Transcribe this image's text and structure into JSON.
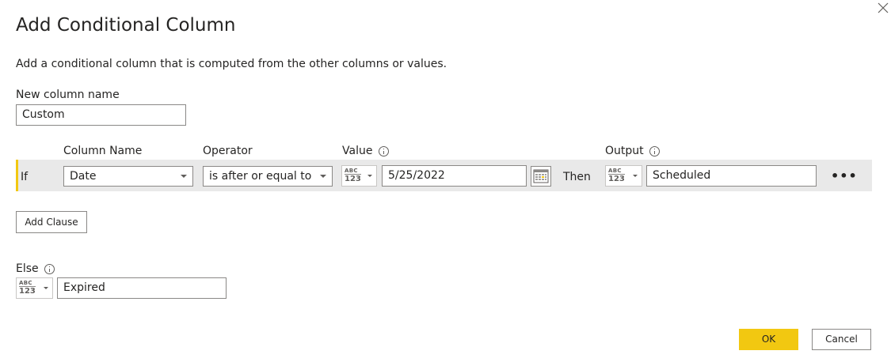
{
  "dialog": {
    "title": "Add Conditional Column",
    "description": "Add a conditional column that is computed from the other columns or values."
  },
  "new_column": {
    "label": "New column name",
    "value": "Custom"
  },
  "headers": {
    "column_name": "Column Name",
    "operator": "Operator",
    "value": "Value",
    "output": "Output"
  },
  "clause": {
    "if_label": "If",
    "column": "Date",
    "operator": "is after or equal to",
    "value_type_abc": "ABC",
    "value_type_num": "123",
    "value": "5/25/2022",
    "then_label": "Then",
    "output_type_abc": "ABC",
    "output_type_num": "123",
    "output": "Scheduled",
    "more": "•••"
  },
  "add_clause_label": "Add Clause",
  "else": {
    "label": "Else",
    "type_abc": "ABC",
    "type_num": "123",
    "value": "Expired"
  },
  "buttons": {
    "ok": "OK",
    "cancel": "Cancel"
  },
  "colors": {
    "accent": "#f2c811",
    "band": "#e9e9e9"
  },
  "icons": [
    "close-icon",
    "info-icon",
    "calendar-icon",
    "chevron-down-icon",
    "more-icon",
    "data-type-icon"
  ]
}
